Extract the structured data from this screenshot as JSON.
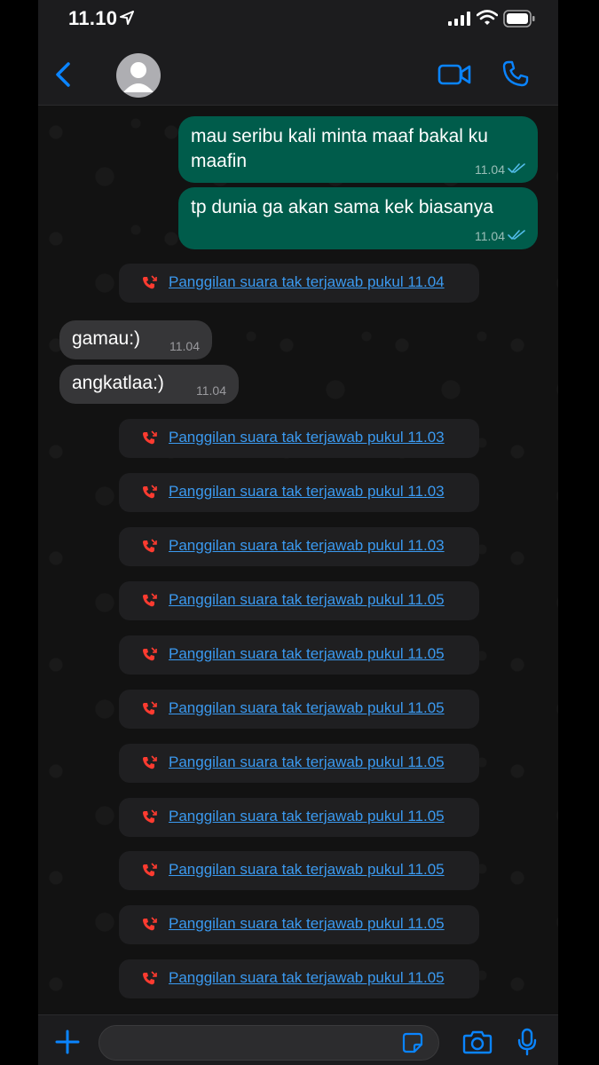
{
  "status_bar": {
    "time": "11.10"
  },
  "header": {
    "contact_name": ""
  },
  "messages": [
    {
      "direction": "out",
      "text": "mau seribu kali minta maaf bakal ku maafin",
      "time": "11.04"
    },
    {
      "direction": "out",
      "text": "tp dunia ga akan sama kek biasanya",
      "time": "11.04"
    },
    {
      "type": "missed_call",
      "text": "Panggilan suara tak terjawab pukul 11.04"
    },
    {
      "direction": "in",
      "text": "gamau:)",
      "time": "11.04"
    },
    {
      "direction": "in",
      "text": "angkatlaa:)",
      "time": "11.04"
    },
    {
      "type": "missed_call",
      "text": "Panggilan suara tak terjawab pukul 11.03"
    },
    {
      "type": "missed_call",
      "text": "Panggilan suara tak terjawab pukul 11.03"
    },
    {
      "type": "missed_call",
      "text": "Panggilan suara tak terjawab pukul 11.03"
    },
    {
      "type": "missed_call",
      "text": "Panggilan suara tak terjawab pukul 11.05"
    },
    {
      "type": "missed_call",
      "text": "Panggilan suara tak terjawab pukul 11.05"
    },
    {
      "type": "missed_call",
      "text": "Panggilan suara tak terjawab pukul 11.05"
    },
    {
      "type": "missed_call",
      "text": "Panggilan suara tak terjawab pukul 11.05"
    },
    {
      "type": "missed_call",
      "text": "Panggilan suara tak terjawab pukul 11.05"
    },
    {
      "type": "missed_call",
      "text": "Panggilan suara tak terjawab pukul 11.05"
    },
    {
      "type": "missed_call",
      "text": "Panggilan suara tak terjawab pukul 11.05"
    },
    {
      "type": "missed_call",
      "text": "Panggilan suara tak terjawab pukul 11.05"
    }
  ],
  "input": {
    "placeholder": ""
  },
  "colors": {
    "accent": "#0a84ff",
    "outgoing_bubble": "#005c4b",
    "incoming_bubble": "#363638",
    "missed_call_icon": "#ff3b30",
    "missed_call_link": "#3b9af0",
    "read_ticks": "#53bdeb"
  },
  "icons": [
    "location-arrow-icon",
    "signal-icon",
    "wifi-icon",
    "battery-icon",
    "back-chevron-icon",
    "avatar-icon",
    "video-call-icon",
    "phone-icon",
    "missed-call-icon",
    "double-check-icon",
    "plus-icon",
    "sticker-icon",
    "camera-icon",
    "microphone-icon"
  ]
}
